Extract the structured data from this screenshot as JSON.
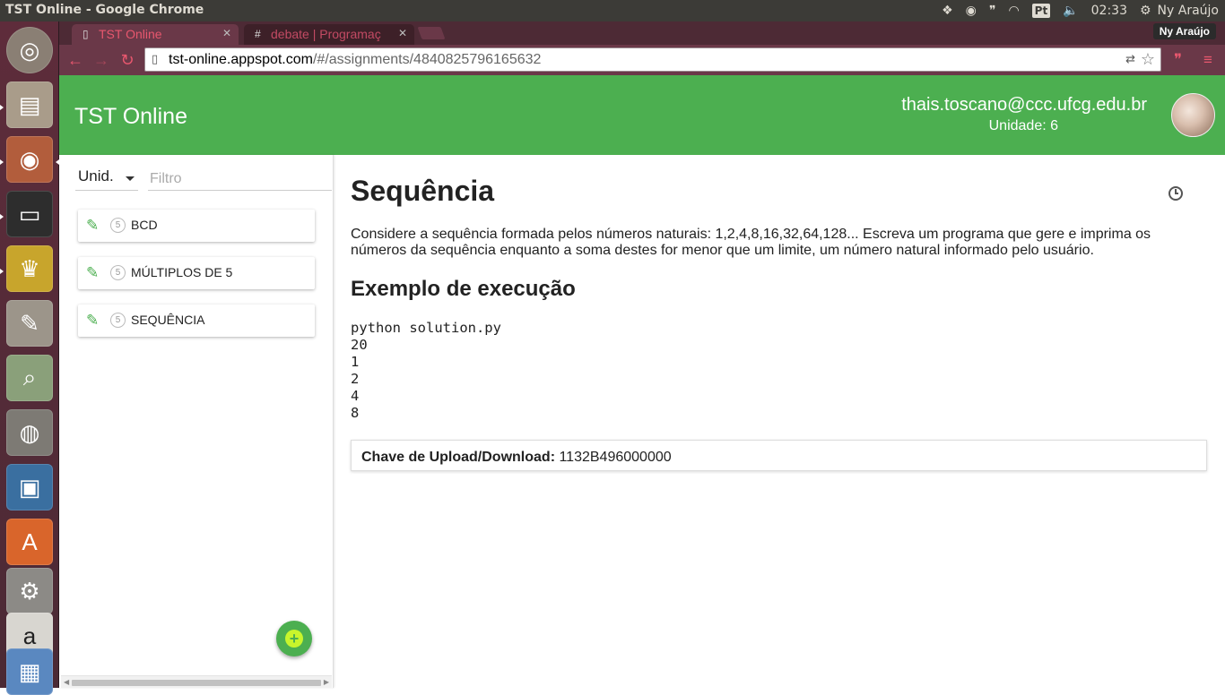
{
  "os_panel": {
    "window_title": "TST Online - Google Chrome",
    "pt_label": "Pt",
    "clock": "02:33",
    "user_name": "Ny Araújo"
  },
  "browser": {
    "tabs": [
      {
        "label": "TST Online",
        "icon": "page-icon"
      },
      {
        "label": "debate | Programaç",
        "icon": "hash-icon"
      }
    ],
    "profile_badge": "Ny Araújo",
    "url_host": "tst-online.appspot.com",
    "url_path": "/#/assignments/4840825796165632"
  },
  "header": {
    "title": "TST Online",
    "email": "thais.toscano@ccc.ufcg.edu.br",
    "unit_text": "Unidade: 6"
  },
  "sidebar": {
    "unit_select": "Unid.",
    "filter_placeholder": "Filtro",
    "items": [
      {
        "badge": "5",
        "name": "BCD"
      },
      {
        "badge": "5",
        "name": "MÚLTIPLOS DE 5"
      },
      {
        "badge": "5",
        "name": "SEQUÊNCIA"
      }
    ],
    "fab_label": "+"
  },
  "main": {
    "title": "Sequência",
    "description": "Considere a sequência formada pelos números naturais: 1,2,4,8,16,32,64,128... Escreva um programa que gere e imprima os números da sequência enquanto a soma destes for menor que um limite, um número natural informado pelo usuário.",
    "example_heading": "Exemplo de execução",
    "example_lines": [
      "python solution.py",
      "20",
      "1",
      "2",
      "4",
      "8"
    ],
    "key_label": "Chave de Upload/Download:",
    "key_value": "1132B496000000"
  },
  "colors": {
    "accent_green": "#4caf50",
    "tab_text_pink": "#e8576e",
    "chrome_frame": "#4d2a35"
  }
}
